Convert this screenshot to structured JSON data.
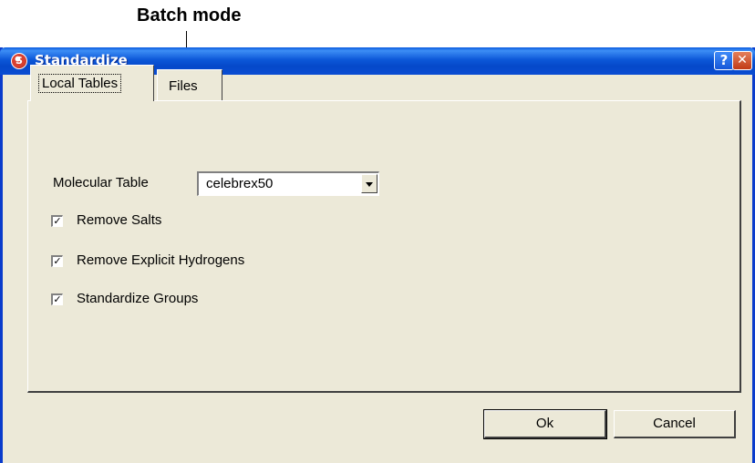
{
  "annotation": {
    "text": "Batch mode"
  },
  "window": {
    "title": "Standardize",
    "app_icon_glyph": "S",
    "help_glyph": "?",
    "close_glyph": "✕"
  },
  "tabs": [
    {
      "label": "Local Tables",
      "selected": true
    },
    {
      "label": "Files",
      "selected": false
    }
  ],
  "form": {
    "molecular_table_label": "Molecular Table",
    "molecular_table_value": "celebrex50",
    "checkboxes": [
      {
        "label": "Remove Salts",
        "checked": true,
        "mark": "✓"
      },
      {
        "label": "Remove Explicit Hydrogens",
        "checked": true,
        "mark": "✓"
      },
      {
        "label": "Standardize Groups",
        "checked": true,
        "mark": "✓"
      }
    ]
  },
  "buttons": {
    "ok": "Ok",
    "cancel": "Cancel"
  },
  "colors": {
    "titlebar": "#0a4dd2",
    "face": "#ece9d8",
    "close": "#c13a16"
  }
}
